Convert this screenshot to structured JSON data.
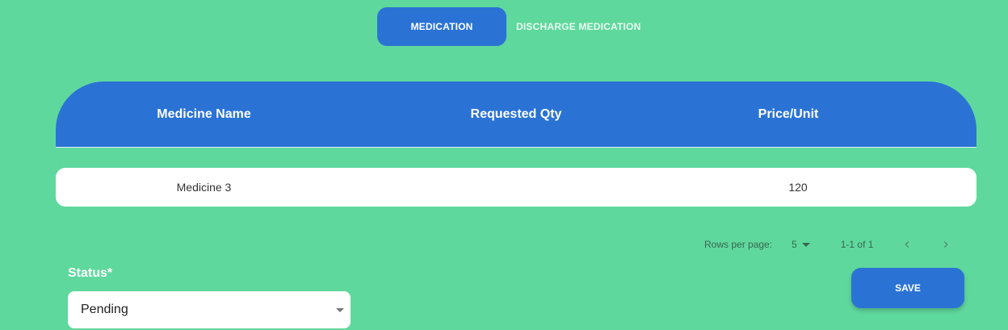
{
  "tabs": [
    {
      "label": "MEDICATION",
      "active": true
    },
    {
      "label": "DISCHARGE MEDICATION",
      "active": false
    }
  ],
  "table": {
    "columns": [
      "Medicine Name",
      "Requested Qty",
      "Price/Unit"
    ],
    "rows": [
      {
        "medicine_name": "Medicine 3",
        "requested_qty": "",
        "price_unit": "120"
      }
    ]
  },
  "pagination": {
    "rows_per_page_label": "Rows per page:",
    "rows_per_page_value": "5",
    "range_text": "1-1 of 1",
    "prev_icon": "chevron-left-icon",
    "next_icon": "chevron-right-icon"
  },
  "status": {
    "label": "Status*",
    "value": "Pending"
  },
  "save_label": "SAVE",
  "colors": {
    "background": "#5fd89d",
    "accent": "#2a73d5",
    "surface": "#ffffff"
  }
}
